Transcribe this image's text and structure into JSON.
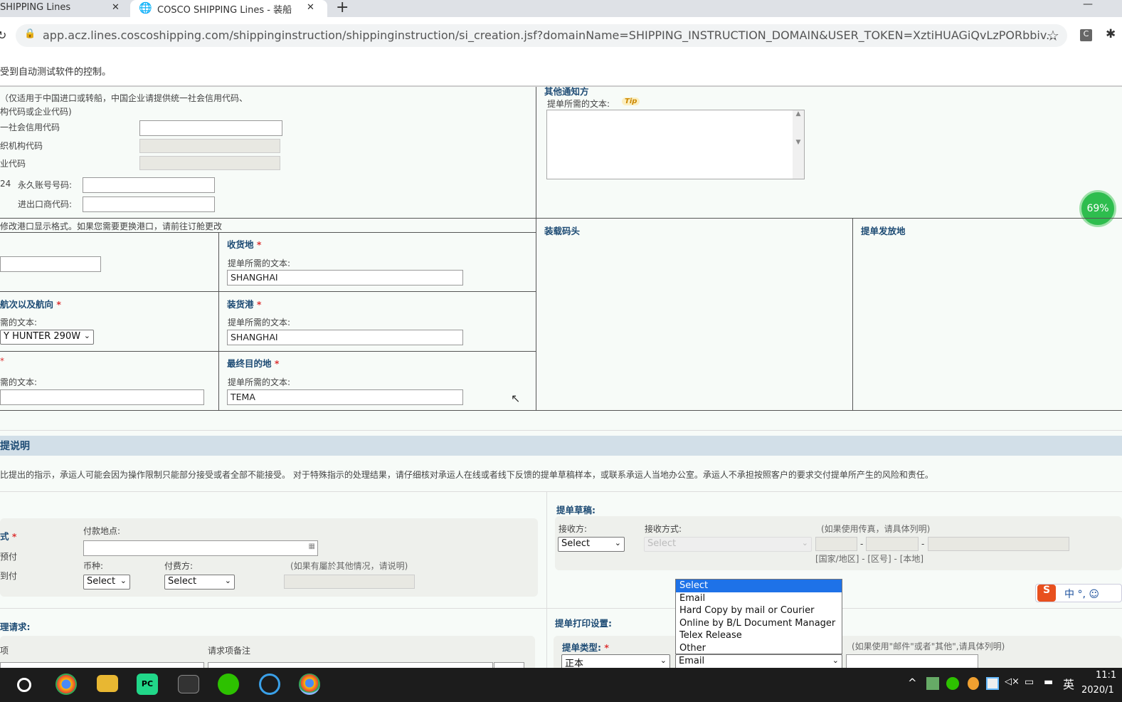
{
  "browser": {
    "tabs": [
      {
        "label": "SHIPPING Lines",
        "close": "✕"
      },
      {
        "label": "COSCO SHIPPING Lines - 装船",
        "close": "✕"
      }
    ],
    "new_tab": "+",
    "url": "app.acz.lines.coscoshipping.com/shippinginstruction/shippinginstruction/si_creation.jsf?domainName=SHIPPING_INSTRUCTION_DOMAIN&USER_TOKEN=XztiHUAGiQvLzPORbbiv...",
    "infobar": "受到自动测试软件的控制。",
    "window_min": "—"
  },
  "codes": {
    "note1": "（仅适用于中国进口或转船，中国企业请提供统一社会信用代码、",
    "note2": "构代码或企业代码)",
    "uscc": "一社会信用代码",
    "org": "织机构代码",
    "ent": "业代码",
    "prefix": "24",
    "pan": "永久账号号码:",
    "iec": "进出口商代码:"
  },
  "notify": {
    "title": "其他通知方",
    "text_label": "提单所需的文本:",
    "tip": "Tip"
  },
  "progress": {
    "label": "69%",
    "value": 69
  },
  "ports": {
    "note": "修改港口显示格式。如果您需要更换港口，请前往订舱更改",
    "loading_terminal": "装载码头",
    "bl_issue_place": "提单发放地",
    "receipt": {
      "title": "收货地",
      "text_label": "提单所需的文本:",
      "value": "SHANGHAI"
    },
    "vessel": {
      "title": "航次以及航向",
      "text_label": "需的文本:",
      "value": "Y HUNTER 290W"
    },
    "pol": {
      "title": "装货港",
      "text_label": "提单所需的文本:",
      "value": "SHANGHAI"
    },
    "dest": {
      "title": "最终目的地",
      "text_label": "提单所需的文本:",
      "value": "TEMA"
    },
    "blank_text_label": "需的文本:"
  },
  "section": {
    "title": "提说明",
    "note": "比提出的指示，承运人可能会因为操作限制只能部分接受或者全部不能接受。 对于特殊指示的处理结果，请仔细核对承运人在线或者线下反馈的提单草稿样本，或联系承运人当地办公室。承运人不承担按照客户的要求交付提单所产生的风险和责任。"
  },
  "payment": {
    "title": "式",
    "prepaid": "预付",
    "collect": "到付",
    "place_label": "付款地点:",
    "currency_label": "币种:",
    "currency": "Select",
    "payer_label": "付费方:",
    "payer": "Select",
    "other_note": "(如果有屬於其他情况，请说明)"
  },
  "requests": {
    "title": "理请求:",
    "item_col": "项",
    "remark_col": "请求项备注"
  },
  "draft": {
    "title": "提单草稿:",
    "receiver_label": "接收方:",
    "receiver": "Select",
    "method_label": "接收方式:",
    "method": "Select",
    "fax_note": "(如果使用传真，请具体列明)",
    "fax_format": "[国家/地区] - [区号] - [本地]"
  },
  "print": {
    "title": "提单打印设置:",
    "type_label": "提单类型:",
    "type": "正本",
    "method": "Email",
    "note": "(如果使用\"邮件\"或者\"其他\",请具体列明)"
  },
  "dropdown": {
    "options": [
      "Select",
      "Email",
      "Hard Copy by mail or Courier",
      "Online by B/L Document Manager",
      "Telex Release",
      "Other"
    ],
    "highlighted": "Select"
  },
  "ime": {
    "lang": "中",
    "punct": "°,"
  },
  "taskbar": {
    "ime": "英",
    "time": "11:1",
    "date": "2020/1"
  }
}
